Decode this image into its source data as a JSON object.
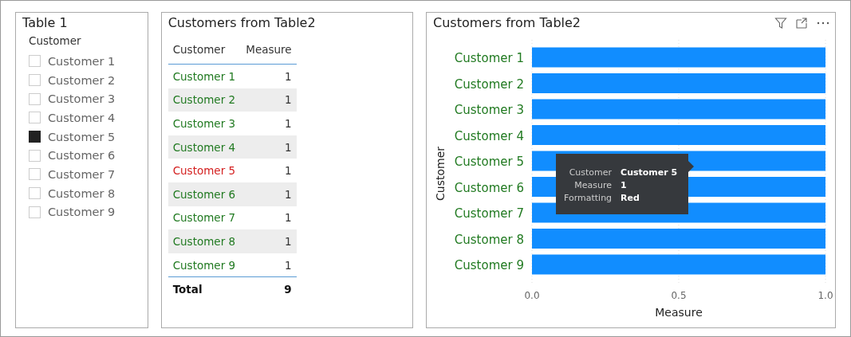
{
  "slicer": {
    "title": "Table 1",
    "field_label": "Customer",
    "items": [
      {
        "label": "Customer 1",
        "checked": false
      },
      {
        "label": "Customer 2",
        "checked": false
      },
      {
        "label": "Customer 3",
        "checked": false
      },
      {
        "label": "Customer 4",
        "checked": false
      },
      {
        "label": "Customer 5",
        "checked": true
      },
      {
        "label": "Customer 6",
        "checked": false
      },
      {
        "label": "Customer 7",
        "checked": false
      },
      {
        "label": "Customer 8",
        "checked": false
      },
      {
        "label": "Customer 9",
        "checked": false
      }
    ]
  },
  "table": {
    "title": "Customers from Table2",
    "columns": [
      "Customer",
      "Measure"
    ],
    "rows": [
      {
        "customer": "Customer 1",
        "measure": "1",
        "color": "#217a21"
      },
      {
        "customer": "Customer 2",
        "measure": "1",
        "color": "#217a21"
      },
      {
        "customer": "Customer 3",
        "measure": "1",
        "color": "#217a21"
      },
      {
        "customer": "Customer 4",
        "measure": "1",
        "color": "#217a21"
      },
      {
        "customer": "Customer 5",
        "measure": "1",
        "color": "#d42020"
      },
      {
        "customer": "Customer 6",
        "measure": "1",
        "color": "#217a21"
      },
      {
        "customer": "Customer 7",
        "measure": "1",
        "color": "#217a21"
      },
      {
        "customer": "Customer 8",
        "measure": "1",
        "color": "#217a21"
      },
      {
        "customer": "Customer 9",
        "measure": "1",
        "color": "#217a21"
      }
    ],
    "total": {
      "label": "Total",
      "value": "9"
    }
  },
  "chart_panel": {
    "title": "Customers from Table2",
    "chart_data": {
      "type": "bar",
      "orientation": "horizontal",
      "xlabel": "Measure",
      "ylabel": "Customer",
      "categories": [
        "Customer 1",
        "Customer 2",
        "Customer 3",
        "Customer 4",
        "Customer 5",
        "Customer 6",
        "Customer 7",
        "Customer 8",
        "Customer 9"
      ],
      "series": [
        {
          "color": "#118dff",
          "values": [
            1,
            1,
            1,
            1,
            1,
            1,
            1,
            1,
            1
          ]
        }
      ],
      "xlim": [
        0,
        1
      ],
      "xticks": [
        {
          "value": 0,
          "label": "0.0"
        },
        {
          "value": 0.5,
          "label": "0.5"
        },
        {
          "value": 1,
          "label": "1.0"
        }
      ]
    },
    "tooltip": {
      "rows": [
        {
          "label": "Customer",
          "value": "Customer 5"
        },
        {
          "label": "Measure",
          "value": "1"
        },
        {
          "label": "Formatting",
          "value": "Red"
        }
      ]
    }
  }
}
